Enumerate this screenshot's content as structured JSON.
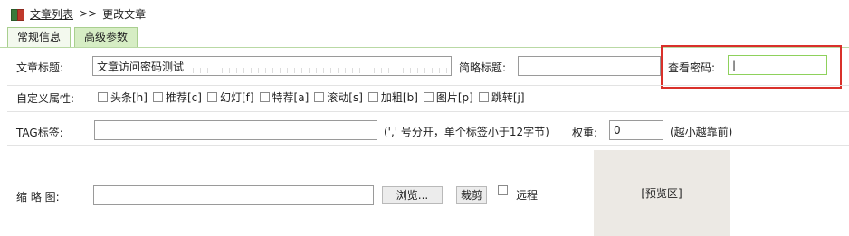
{
  "breadcrumb": {
    "link": "文章列表",
    "separator": ">>",
    "current": "更改文章"
  },
  "tabs": [
    {
      "label": "常规信息"
    },
    {
      "label": "高级参数"
    }
  ],
  "form": {
    "title_label": "文章标题:",
    "title_value": "文章访问密码测试",
    "short_title_label": "简略标题:",
    "short_title_value": "",
    "password_label": "查看密码:",
    "password_value": "|",
    "attr_label": "自定义属性:",
    "attrs": [
      {
        "label": "头条[h]"
      },
      {
        "label": "推荐[c]"
      },
      {
        "label": "幻灯[f]"
      },
      {
        "label": "特荐[a]"
      },
      {
        "label": "滚动[s]"
      },
      {
        "label": "加粗[b]"
      },
      {
        "label": "图片[p]"
      },
      {
        "label": "跳转[j]"
      }
    ],
    "tag_label": "TAG标签:",
    "tag_value": "",
    "tag_hint": "(',' 号分开，单个标签小于12字节)",
    "weight_label": "权重:",
    "weight_value": "0",
    "weight_hint": "(越小越靠前)",
    "thumb_label": "缩 略 图:",
    "thumb_value": "",
    "browse_button": "浏览...",
    "crop_button": "裁剪",
    "remote_label": "远程",
    "preview_text": "[预览区]"
  },
  "colors": {
    "highlight_box": "#d9302a",
    "tab_border": "#a9cf8f",
    "active_input_border": "#8ed15c"
  }
}
